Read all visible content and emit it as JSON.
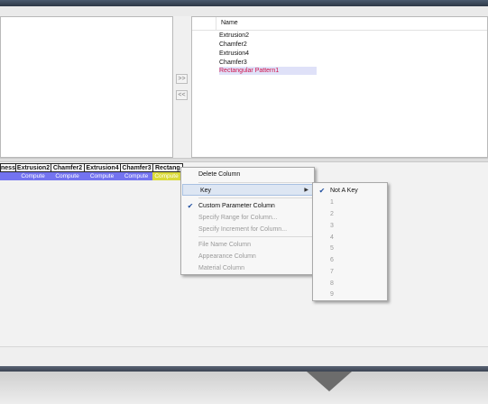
{
  "left_list": {
    "header": "Name",
    "rows": [
      {
        "label": "Extrusion2",
        "selected": false
      },
      {
        "label": "Chamfer2",
        "selected": false
      },
      {
        "label": "Extrusion4",
        "selected": false
      },
      {
        "label": "Chamfer3",
        "selected": false
      },
      {
        "label": "Rectangular Pattern1",
        "selected": true
      }
    ]
  },
  "arrow_buttons": {
    "add": ">>",
    "remove": "<<"
  },
  "grid": {
    "columns": [
      {
        "header": "ness",
        "cell": "",
        "cell_highlighted": false
      },
      {
        "header": "Extrusion2",
        "cell": "Compute",
        "cell_highlighted": false
      },
      {
        "header": "Chamfer2",
        "cell": "Compute",
        "cell_highlighted": false
      },
      {
        "header": "Extrusion4",
        "cell": "Compute",
        "cell_highlighted": false
      },
      {
        "header": "Chamfer3",
        "cell": "Compute",
        "cell_highlighted": false
      },
      {
        "header": "Rectang",
        "cell": "Compute",
        "cell_highlighted": true
      }
    ]
  },
  "context_menu": {
    "delete_column": "Delete Column",
    "key": "Key",
    "custom_parameter_column": "Custom Parameter Column",
    "specify_range": "Specify Range for Column...",
    "specify_increment": "Specify Increment for Column...",
    "file_name_column": "File Name Column",
    "appearance_column": "Appearance Column",
    "material_column": "Material Column"
  },
  "key_submenu": {
    "items": [
      "Not A Key",
      "1",
      "2",
      "3",
      "4",
      "5",
      "6",
      "7",
      "8",
      "9"
    ],
    "checked_index": 0
  },
  "colors": {
    "selected_row_text": "#d0104a",
    "grid_cell_bg": "#7373f0",
    "grid_cell_highlight": "#dada3a",
    "check_color": "#204fa0"
  }
}
